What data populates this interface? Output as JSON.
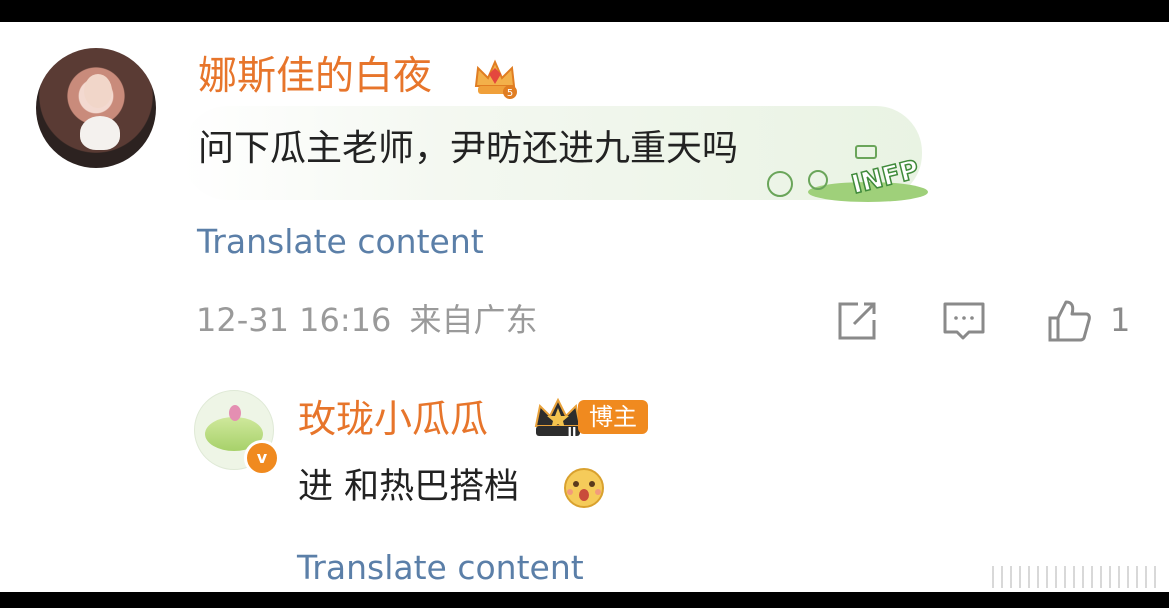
{
  "comment": {
    "user_name": "娜斯佳的白夜",
    "level_badge": "5",
    "text": "问下瓜主老师，尹昉还进九重天吗",
    "sticker_text": "INFP",
    "translate_label": "Translate content",
    "timestamp": "12-31 16:16",
    "location": "来自广东",
    "like_count": "1"
  },
  "reply": {
    "user_name": "玫珑小瓜瓜",
    "level_badge": "II",
    "role_badge": "博主",
    "text": "进 和热巴搭档",
    "translate_label": "Translate content",
    "verified_badge": "v"
  },
  "colors": {
    "username": "#e7752b",
    "translate": "#5b7fa8",
    "meta": "#9a9a9a",
    "badge_orange": "#f08a1f"
  }
}
